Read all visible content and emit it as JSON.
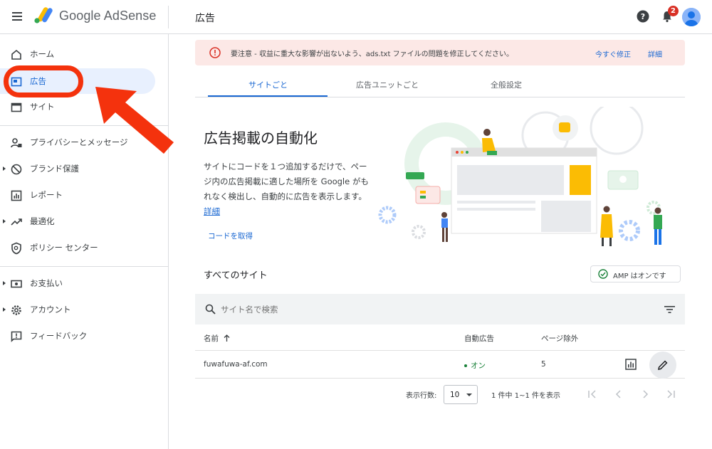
{
  "app": {
    "brand": "Google AdSense",
    "page_title": "広告",
    "notification_count": "2"
  },
  "sidebar": {
    "items": [
      {
        "label": "ホーム",
        "icon": "home-icon"
      },
      {
        "label": "広告",
        "icon": "ads-icon",
        "active": true
      },
      {
        "label": "サイト",
        "icon": "sites-icon"
      },
      {
        "label": "プライバシーとメッセージ",
        "icon": "privacy-icon"
      },
      {
        "label": "ブランド保護",
        "icon": "block-icon"
      },
      {
        "label": "レポート",
        "icon": "report-icon"
      },
      {
        "label": "最適化",
        "icon": "trend-icon"
      },
      {
        "label": "ポリシー センター",
        "icon": "policy-icon"
      },
      {
        "label": "お支払い",
        "icon": "payments-icon"
      },
      {
        "label": "アカウント",
        "icon": "settings-icon"
      },
      {
        "label": "フィードバック",
        "icon": "feedback-icon"
      }
    ]
  },
  "alert": {
    "text": "要注意 - 収益に重大な影響が出ないよう、ads.txt ファイルの問題を修正してください。",
    "fix_now": "今すぐ修正",
    "details": "詳細"
  },
  "tabs": [
    {
      "label": "サイトごと",
      "active": true
    },
    {
      "label": "広告ユニットごと"
    },
    {
      "label": "全般設定"
    }
  ],
  "hero": {
    "title": "広告掲載の自動化",
    "body": "サイトにコードを１つ追加するだけで、ページ内の広告掲載に適した場所を Google がもれなく検出し、自動的に広告を表示します。",
    "details_link": "詳細",
    "get_code": "コードを取得"
  },
  "sites": {
    "title": "すべてのサイト",
    "amp_status": "AMP はオンです",
    "search_placeholder": "サイト名で検索",
    "columns": {
      "name": "名前",
      "auto_ads": "自動広告",
      "page_exclusions": "ページ除外"
    },
    "rows": [
      {
        "name": "fuwafuwa-af.com",
        "auto_ads": "オン",
        "page_exclusions": "5"
      }
    ]
  },
  "pagination": {
    "rows_label": "表示行数:",
    "rows_value": "10",
    "range": "1 件中 1~1 件を表示"
  },
  "colors": {
    "accent": "#1967d2",
    "highlight": "#f4320d",
    "alert_bg": "#fce8e6",
    "success": "#188038"
  }
}
